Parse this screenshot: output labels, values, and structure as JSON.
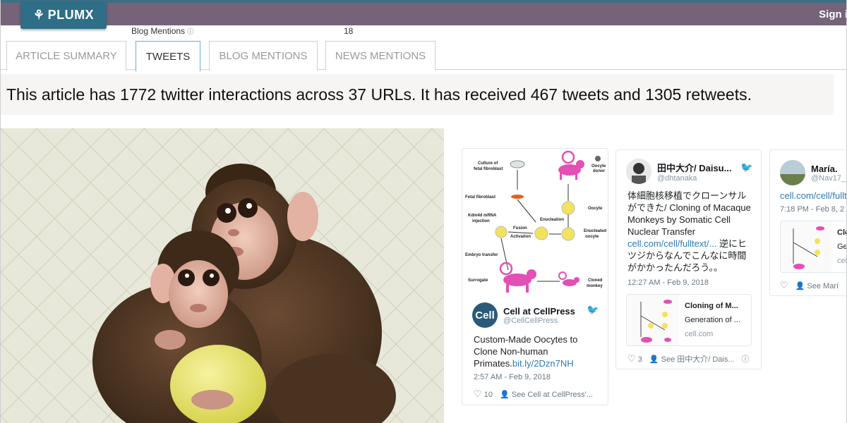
{
  "header": {
    "logo_text": "PLUMX",
    "logo_icon": "plumx-leaf-icon",
    "signin_label": "Sign i",
    "colors": {
      "topbar": "#76637a",
      "logo": "#2e6e86",
      "accent": "#6aaed0"
    }
  },
  "metric": {
    "label": "Blog Mentions",
    "value": "18"
  },
  "tabs": [
    {
      "label": "ARTICLE SUMMARY",
      "active": false
    },
    {
      "label": "TWEETS",
      "active": true
    },
    {
      "label": "BLOG MENTIONS",
      "active": false
    },
    {
      "label": "NEWS MENTIONS",
      "active": false
    }
  ],
  "summary_text": "This article has 1772 twitter interactions across 37 URLs. It has received 467 tweets and 1305 retweets.",
  "diagram": {
    "labels": {
      "culture": "Culture of",
      "culture2": "fetal fibroblast",
      "fibroblast": "Fetal fibroblast",
      "kdm": "Kdm4d mRNA",
      "kdm2": "injection",
      "fusion": "Fusion",
      "activation": "Activation",
      "embryo": "Embryo transfer",
      "surrogate": "Surrogate",
      "oocyte_donor": "Oocyte",
      "oocyte_donor2": "donor",
      "oocyte": "Oocyte",
      "enucleation": "Enucleation",
      "enucleated": "Enucleated",
      "enucleated2": "oocyte",
      "cloned": "Cloned",
      "cloned2": "monkey"
    }
  },
  "tweets": [
    {
      "name": "Cell at CellPress",
      "handle": "@CellCellPress",
      "avatar_text": "Cell",
      "text": "Custom-Made Oocytes to Clone Non-human Primates.",
      "link": "bit.ly/2Dzn7NH",
      "time": "2:57 AM - Feb 9, 2018",
      "likes": "10",
      "see_label": "See Cell at CellPress'..."
    },
    {
      "name": "田中大介/ Daisu...",
      "handle": "@dhtanaka",
      "text_lines": [
        "体細胞核移植でクローンサル",
        "ができた/ Cloning of Macaque",
        "Monkeys by Somatic Cell",
        "Nuclear Transfer"
      ],
      "link": "cell.com/cell/fulltext/...",
      "text_after": " 逆にヒ",
      "text_lines2": [
        "ツジからなんでこんなに時間",
        "がかかったんだろう。。"
      ],
      "time": "12:27 AM - Feb 9, 2018",
      "preview_title": "Cloning of M...",
      "preview_desc": "Generation of ...",
      "preview_domain": "cell.com",
      "likes": "3",
      "see_label": "See 田中大介/ Dais..."
    },
    {
      "name": "María.",
      "handle": "@Nav17_",
      "link": "cell.com/cell/fullt",
      "time": "7:18 PM - Feb 8, 2",
      "preview_title": "Clo",
      "preview_desc": "Ge",
      "preview_domain": "cel",
      "see_label": "See Marí"
    }
  ]
}
